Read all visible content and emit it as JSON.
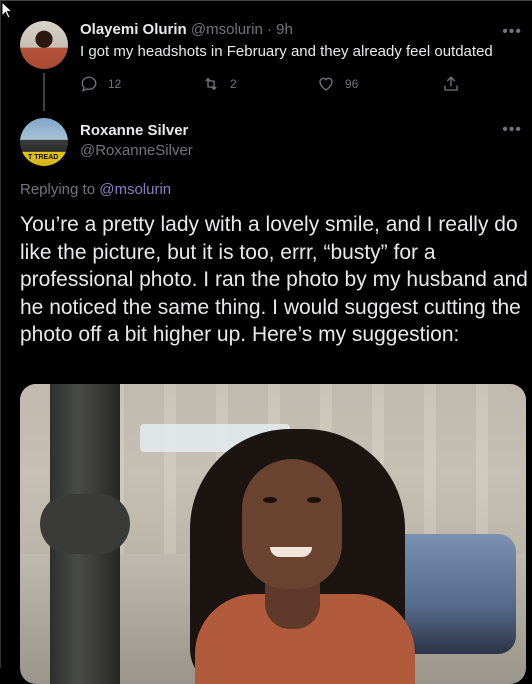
{
  "parent_tweet": {
    "display_name": "Olayemi Olurin",
    "handle_time": "@msolurin · 9h",
    "text": "I got my headshots in February and they already feel outdated",
    "reply_count": "12",
    "retweet_count": "2",
    "like_count": "96"
  },
  "reply_tweet": {
    "display_name": "Roxanne Silver",
    "handle": "@RoxanneSilver",
    "replying_prefix": "Replying to",
    "replying_to": "@msolurin",
    "avatar_text": "T TREAD",
    "text": "You’re a pretty lady with a lovely smile, and I really do like the picture, but it is too, errr, “busty” for a professional photo.  I ran the photo by my husband and he noticed the same thing.  I would suggest cutting the photo off a bit higher up.  Here’s my suggestion:"
  },
  "more_label": "•••",
  "icons": [
    "reply-icon",
    "retweet-icon",
    "like-icon",
    "share-icon",
    "more-icon"
  ],
  "colors": {
    "background": "#000000",
    "text": "#e7e9ea",
    "muted": "#71767b",
    "link": "#8e7cc3"
  }
}
